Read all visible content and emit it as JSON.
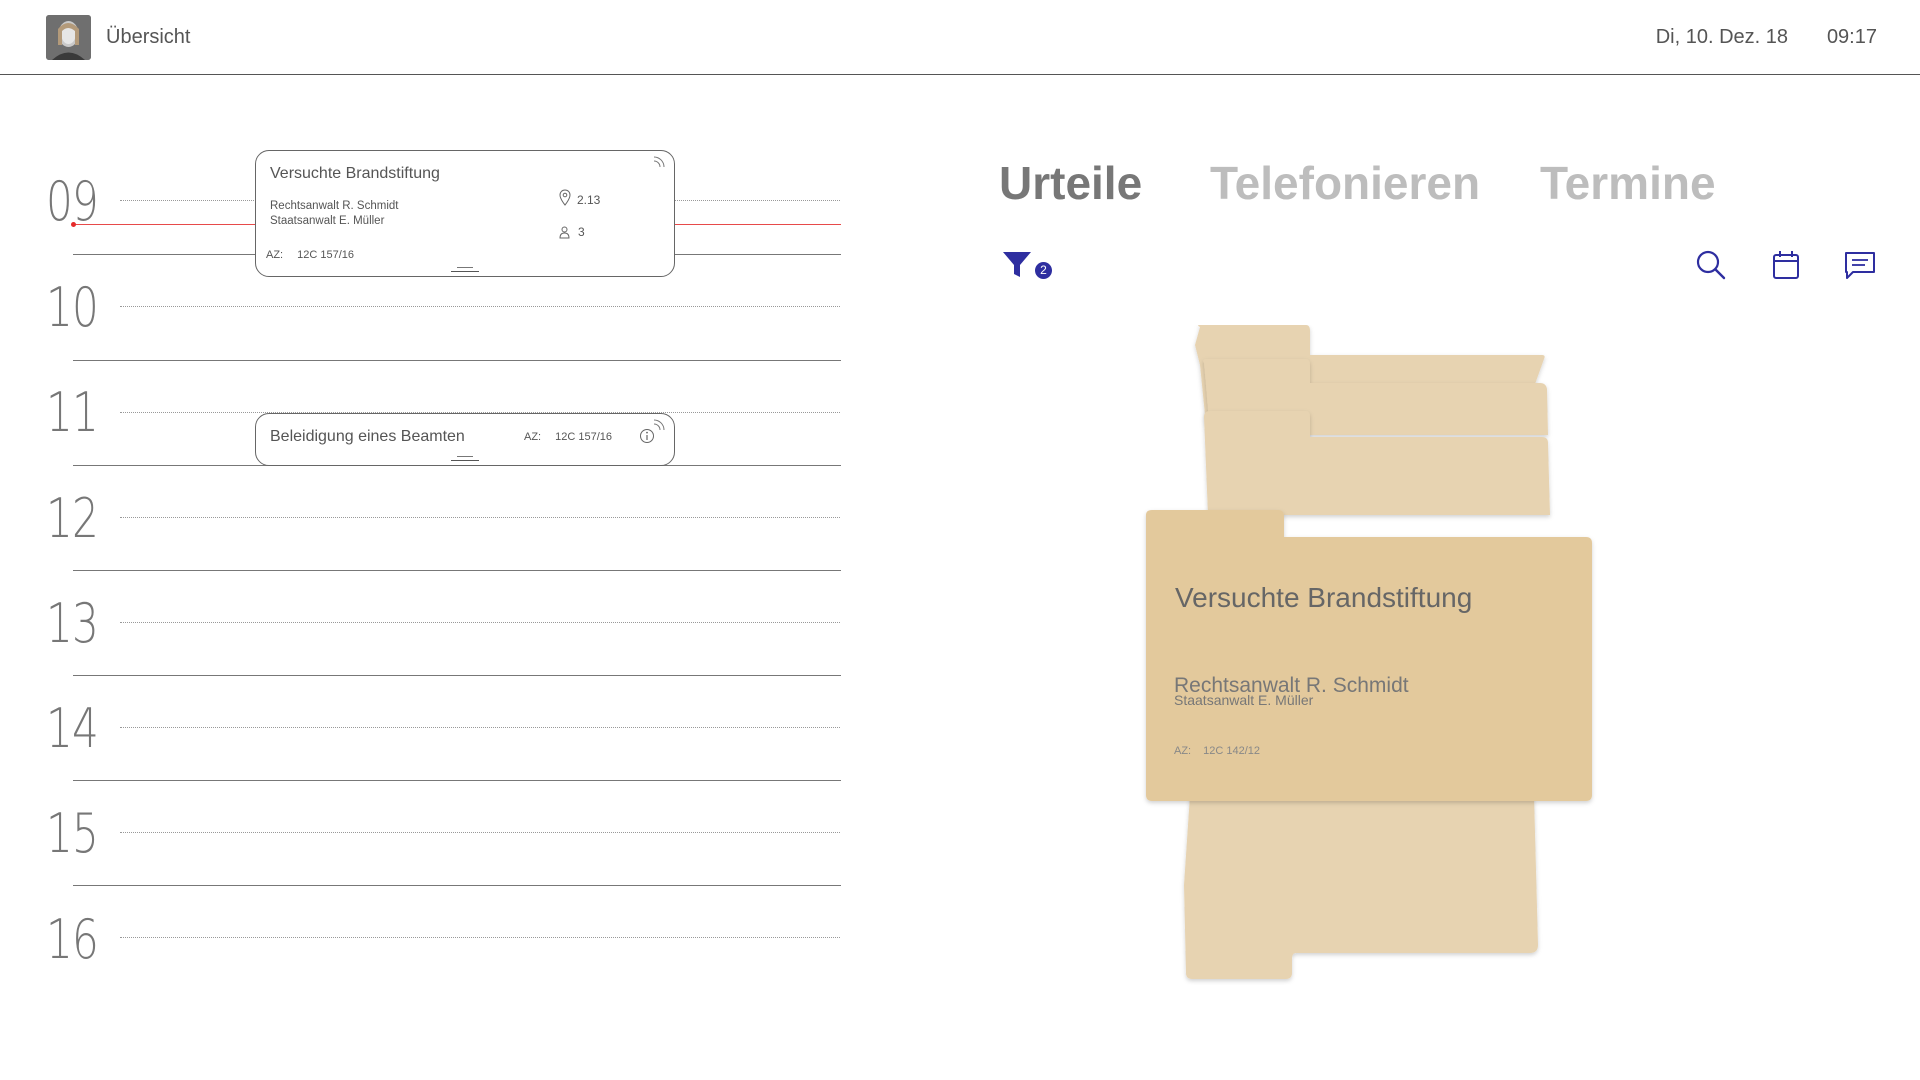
{
  "header": {
    "title": "Übersicht",
    "date": "Di, 10. Dez. 18",
    "time": "09:17"
  },
  "timeline": {
    "hours": [
      "09",
      "10",
      "11",
      "12",
      "13",
      "14",
      "15",
      "16"
    ],
    "events": [
      {
        "title": "Versuchte Brandstiftung",
        "lawyer": "Rechtsanwalt R. Schmidt",
        "prosecutor": "Staatsanwalt E. Müller",
        "room": "2.13",
        "persons": "3",
        "az_label": "AZ:",
        "az": "12C 157/16"
      },
      {
        "title": "Beleidigung eines Beamten",
        "az_label": "AZ:",
        "az": "12C 157/16"
      }
    ]
  },
  "tabs": [
    {
      "label": "Urteile",
      "active": true
    },
    {
      "label": "Telefonieren",
      "active": false
    },
    {
      "label": "Termine",
      "active": false
    }
  ],
  "toolbar": {
    "filter_count": "2",
    "accent": "#2e2ea0",
    "icons": [
      "filter-icon",
      "search-icon",
      "calendar-icon",
      "message-icon"
    ]
  },
  "folder": {
    "title": "Versuchte Brandstiftung",
    "lawyer": "Rechtsanwalt R. Schmidt",
    "prosecutor": "Staatsanwalt E. Müller",
    "az_label": "AZ:",
    "az": "12C 142/12",
    "color": "#e3c99c"
  }
}
